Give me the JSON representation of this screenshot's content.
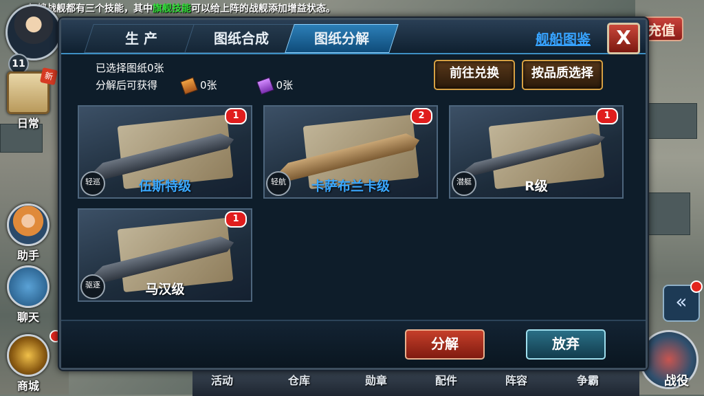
{
  "ticker": {
    "prefix": "每艘战舰都有三个技能，其中",
    "highlight": "旗舰技能",
    "suffix": "可以给上阵的战舰添加增益状态。"
  },
  "player": {
    "level": "11"
  },
  "left_menu": {
    "daily": "日常",
    "new_badge": "新",
    "assistant": "助手",
    "chat": "聊天",
    "shop": "商城"
  },
  "recharge_label": "充值",
  "collapse_icon": "«",
  "battle_label": "战役",
  "bottom_nav": [
    "活动",
    "仓库",
    "勋章",
    "配件",
    "阵容",
    "争霸"
  ],
  "panel": {
    "tabs": [
      {
        "label": "生 产",
        "active": false
      },
      {
        "label": "图纸合成",
        "active": false
      },
      {
        "label": "图纸分解",
        "active": true
      }
    ],
    "gallery_link": "舰船图鉴",
    "close_label": "X",
    "selected_text": "已选择图纸0张",
    "obtain_label": "分解后可获得",
    "resources": [
      {
        "icon": "orange-blueprint-icon",
        "value": "0张"
      },
      {
        "icon": "purple-blueprint-icon",
        "value": "0张"
      }
    ],
    "exchange_button": "前往兑换",
    "quality_button": "按品质选择",
    "ships": [
      {
        "name": "伍斯特级",
        "type": "轻巡",
        "count": "1",
        "name_color": "blue"
      },
      {
        "name": "卡萨布兰卡级",
        "type": "轻航",
        "count": "2",
        "name_color": "blue"
      },
      {
        "name": "R级",
        "type": "潜艇",
        "count": "1",
        "name_color": "white"
      },
      {
        "name": "马汉级",
        "type": "驱逐",
        "count": "1",
        "name_color": "white"
      }
    ],
    "decompose_button": "分解",
    "abandon_button": "放弃"
  }
}
